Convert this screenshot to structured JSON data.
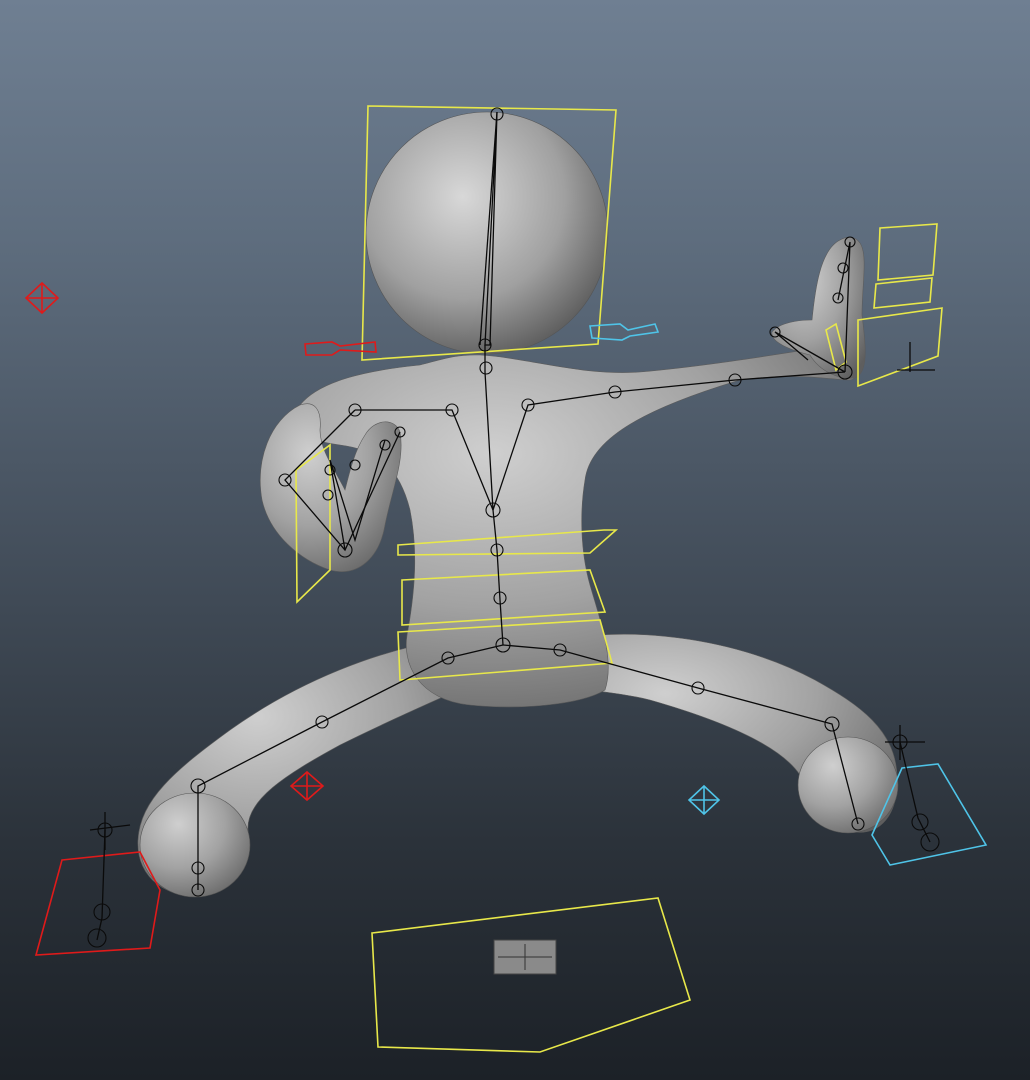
{
  "viewport": {
    "panel": "perspective-viewport",
    "background_top": "#6f7f92",
    "background_bottom": "#1c2127"
  },
  "scene": {
    "character": "humanoid-character-mesh",
    "mesh_color": "#a9a9a9",
    "skeleton_color": "#0a0a0a",
    "controls": {
      "center_color": "#e8e84a",
      "left_color": "#e01a1a",
      "right_color": "#4fc4e8"
    },
    "icons": [
      "head-control",
      "ik-handle-icon",
      "pole-vector-icon",
      "foot-control",
      "main-control-icon"
    ]
  }
}
